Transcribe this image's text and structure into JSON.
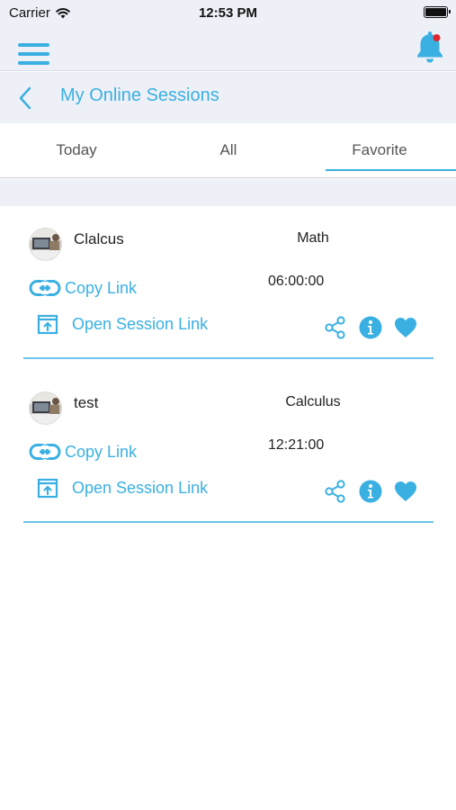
{
  "status_bar": {
    "carrier": "Carrier",
    "time": "12:53 PM"
  },
  "nav": {
    "menu_icon": "hamburger-menu-icon",
    "notification_icon": "bell-icon",
    "notification_dot_color": "#e0262b"
  },
  "header": {
    "title": "My Online Sessions",
    "back_icon": "chevron-left-icon"
  },
  "tabs": {
    "items": [
      "Today",
      "All",
      "Favorite"
    ],
    "selected": "Favorite"
  },
  "colors": {
    "accent": "#3ab0e2",
    "band": "#eef0f7",
    "divider": "#6cc4ea"
  },
  "sessions": [
    {
      "tutor": "Clalcus",
      "subject": "Math",
      "time": "06:00:00",
      "copy_link_label": "Copy Link",
      "open_session_label": "Open Session Link",
      "favorite": true
    },
    {
      "tutor": "test",
      "subject": "Calculus",
      "time": "12:21:00",
      "copy_link_label": "Copy Link",
      "open_session_label": "Open Session Link",
      "favorite": true
    }
  ]
}
